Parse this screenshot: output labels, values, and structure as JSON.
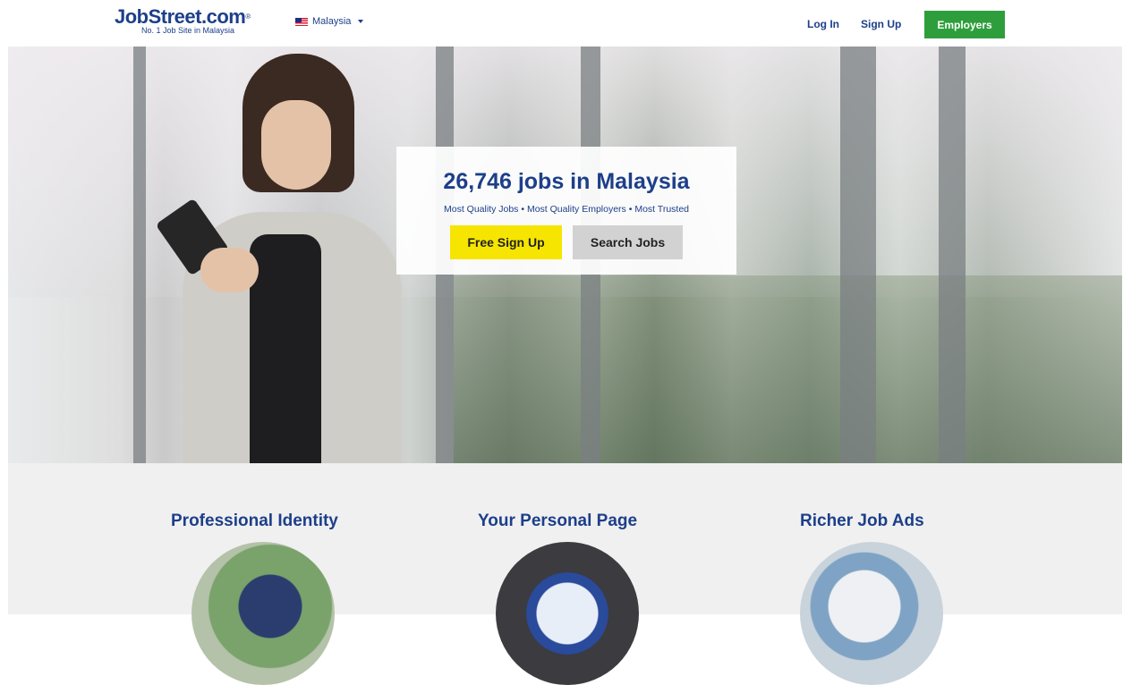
{
  "header": {
    "logo_text": "JobStreet.com",
    "logo_mark": "®",
    "tagline": "No. 1 Job Site in Malaysia",
    "country": "Malaysia",
    "login": "Log In",
    "signup": "Sign Up",
    "employers": "Employers",
    "colors": {
      "brand": "#1d3f8a",
      "employers_button": "#2e9e3c"
    }
  },
  "hero": {
    "headline": "26,746 jobs in Malaysia",
    "subline": "Most Quality Jobs • Most Quality Employers • Most Trusted",
    "primary_cta": "Free Sign Up",
    "secondary_cta": "Search Jobs",
    "colors": {
      "primary_cta": "#f6e500",
      "secondary_cta": "#d2d2d2"
    }
  },
  "features": [
    {
      "title": "Professional Identity"
    },
    {
      "title": "Your Personal Page"
    },
    {
      "title": "Richer Job Ads"
    }
  ]
}
